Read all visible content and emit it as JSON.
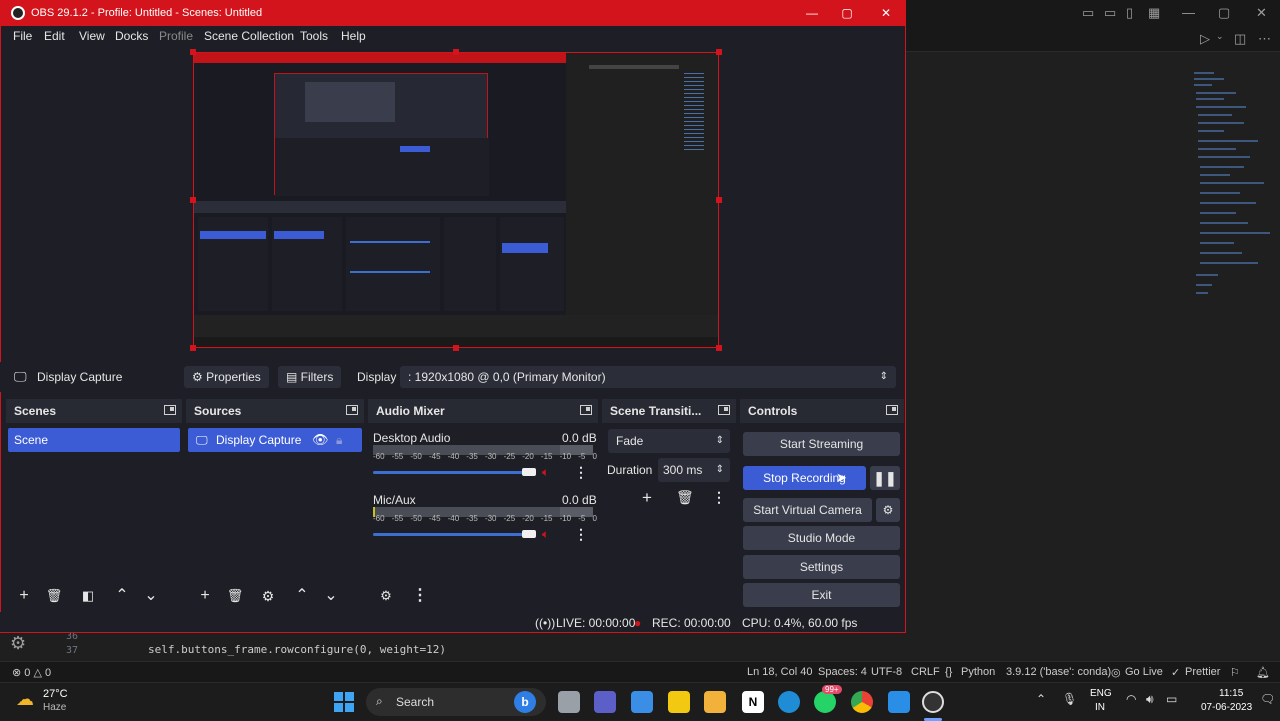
{
  "obs": {
    "title": "OBS 29.1.2 - Profile: Untitled - Scenes: Untitled",
    "menu": [
      "File",
      "Edit",
      "View",
      "Docks",
      "Profile",
      "Scene Collection",
      "Tools",
      "Help"
    ],
    "context": {
      "source_name": "Display Capture",
      "properties": "Properties",
      "filters": "Filters",
      "display_label": "Display",
      "display_value": ": 1920x1080 @ 0,0 (Primary Monitor)"
    },
    "docks": {
      "scenes": {
        "title": "Scenes",
        "items": [
          "Scene"
        ]
      },
      "sources": {
        "title": "Sources",
        "items": [
          "Display Capture"
        ]
      },
      "mixer": {
        "title": "Audio Mixer",
        "channels": [
          {
            "name": "Desktop Audio",
            "level": "0.0 dB"
          },
          {
            "name": "Mic/Aux",
            "level": "0.0 dB"
          }
        ],
        "ticks": [
          "-60",
          "-55",
          "-50",
          "-45",
          "-40",
          "-35",
          "-30",
          "-25",
          "-20",
          "-15",
          "-10",
          "-5",
          "0"
        ]
      },
      "transitions": {
        "title": "Scene Transiti...",
        "selected": "Fade",
        "duration_label": "Duration",
        "duration_value": "300 ms"
      },
      "controls": {
        "title": "Controls",
        "start_streaming": "Start Streaming",
        "stop_recording": "Stop Recording",
        "start_virtual_camera": "Start Virtual Camera",
        "studio_mode": "Studio Mode",
        "settings": "Settings",
        "exit": "Exit"
      }
    },
    "status": {
      "live": "LIVE: 00:00:00",
      "rec": "REC: 00:00:00",
      "cpu": "CPU: 0.4%, 60.00 fps"
    }
  },
  "vscode": {
    "line_numbers": [
      "36",
      "37"
    ],
    "code_line": "self.buttons_frame.rowconfigure(0, weight=12)",
    "status": {
      "problems": "⊗ 0 △ 0",
      "position": "Ln 18, Col 40",
      "spaces": "Spaces: 4",
      "encoding": "UTF-8",
      "eol": "CRLF",
      "language": "Python",
      "interpreter": "3.9.12 ('base': conda)",
      "golive": "Go Live",
      "prettier": "Prettier"
    }
  },
  "taskbar": {
    "weather_temp": "27°C",
    "weather_desc": "Haze",
    "search": "Search",
    "badge": "99+",
    "lang1": "ENG",
    "lang2": "IN",
    "time": "11:15",
    "date": "07-06-2023"
  },
  "colors": {
    "obs_red": "#d4141c",
    "accent_blue": "#3c5cd6",
    "vscode_bg": "#1f1f1f"
  }
}
